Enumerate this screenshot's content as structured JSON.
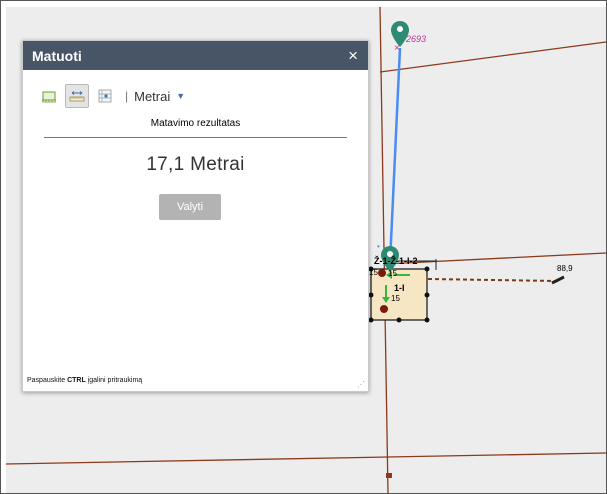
{
  "widget": {
    "title": "Matuoti",
    "close_symbol": "×",
    "tools": [
      {
        "icon": "area-measure-icon",
        "active": false
      },
      {
        "icon": "distance-measure-icon",
        "active": true
      },
      {
        "icon": "location-measure-icon",
        "active": false
      }
    ],
    "separator": "|",
    "unit": "Metrai",
    "result_label": "Matavimo rezultatas",
    "result_value": "17,1 Metrai",
    "clear_label": "Valyti",
    "hint_before": "Paspauskite ",
    "hint_key": "CTRL",
    "hint_after": " įgalini pritraukimą",
    "resize_grip": "⋰"
  },
  "map": {
    "labels": {
      "parcel_2693": "2693",
      "parcel_top": "Ž-1-Ž-1-I-2",
      "parcel_1i": "1-I",
      "num_15a": "15",
      "num_15b": "15",
      "num_15c": "15",
      "value_88_9": "88,9"
    },
    "colors": {
      "boundary": "#8b3a1a",
      "measure_line": "#4a8cf0",
      "parcel_fill": "#f6e6c4",
      "pin": "#2f8a74",
      "label_magenta": "#c0329a"
    }
  }
}
